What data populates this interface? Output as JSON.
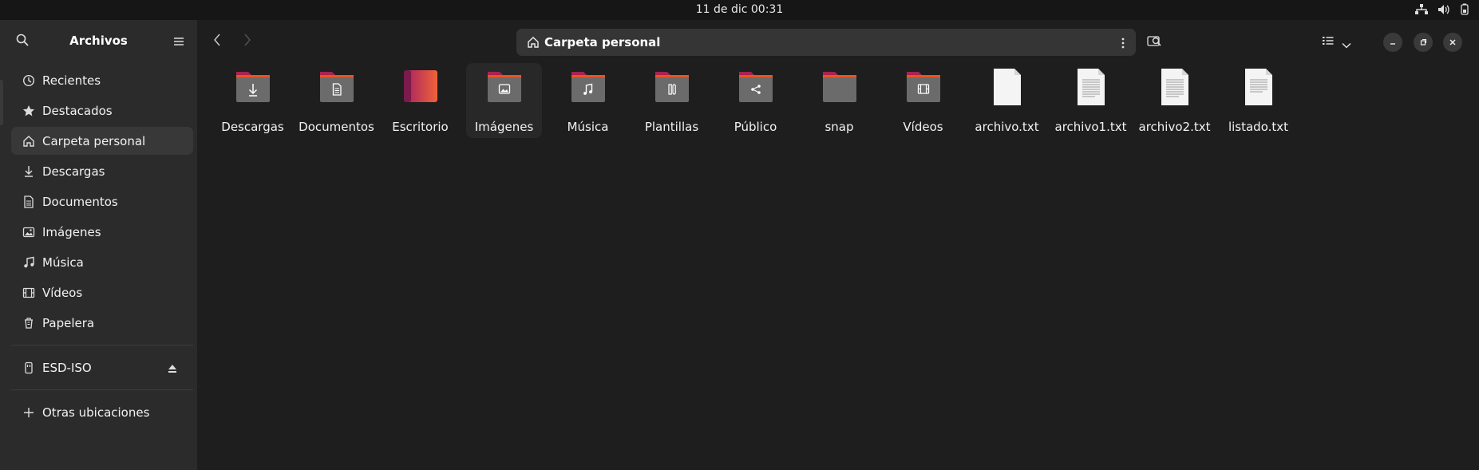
{
  "topbar": {
    "clock": "11 de dic  00:31"
  },
  "window": {
    "title": "Archivos",
    "path_label": "Carpeta personal"
  },
  "sidebar": {
    "items": [
      {
        "label": "Recientes",
        "icon": "clock-icon"
      },
      {
        "label": "Destacados",
        "icon": "star-icon"
      },
      {
        "label": "Carpeta personal",
        "icon": "home-icon",
        "active": true
      },
      {
        "label": "Descargas",
        "icon": "download-icon"
      },
      {
        "label": "Documentos",
        "icon": "document-icon"
      },
      {
        "label": "Imágenes",
        "icon": "image-icon"
      },
      {
        "label": "Música",
        "icon": "music-icon"
      },
      {
        "label": "Vídeos",
        "icon": "video-icon"
      },
      {
        "label": "Papelera",
        "icon": "trash-icon"
      }
    ],
    "devices": [
      {
        "label": "ESD-ISO",
        "icon": "usb-drive-icon"
      }
    ],
    "other": {
      "label": "Otras ubicaciones",
      "icon": "plus-icon"
    }
  },
  "files": [
    {
      "name": "Descargas",
      "kind": "folder",
      "emblem": "download-icon"
    },
    {
      "name": "Documentos",
      "kind": "folder",
      "emblem": "document-icon"
    },
    {
      "name": "Escritorio",
      "kind": "desktop-folder"
    },
    {
      "name": "Imágenes",
      "kind": "folder",
      "emblem": "image-icon"
    },
    {
      "name": "Música",
      "kind": "folder",
      "emblem": "music-icon"
    },
    {
      "name": "Plantillas",
      "kind": "folder",
      "emblem": "template-icon"
    },
    {
      "name": "Público",
      "kind": "folder",
      "emblem": "share-icon"
    },
    {
      "name": "snap",
      "kind": "folder",
      "emblem": ""
    },
    {
      "name": "Vídeos",
      "kind": "folder",
      "emblem": "video-icon"
    },
    {
      "name": "archivo.txt",
      "kind": "blank-file"
    },
    {
      "name": "archivo1.txt",
      "kind": "text-file"
    },
    {
      "name": "archivo2.txt",
      "kind": "text-file"
    },
    {
      "name": "listado.txt",
      "kind": "text-file"
    }
  ],
  "colors": {
    "folder_body": "#6b6b6b",
    "folder_tab": "#a8234f",
    "folder_accent": "#e95420"
  }
}
